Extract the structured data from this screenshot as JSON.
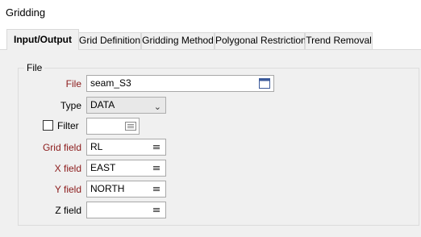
{
  "window": {
    "title": "Gridding"
  },
  "tabs": [
    {
      "label": "Input/Output",
      "active": true
    },
    {
      "label": "Grid Definition",
      "active": false
    },
    {
      "label": "Gridding Method",
      "active": false
    },
    {
      "label": "Polygonal Restriction",
      "active": false
    },
    {
      "label": "Trend Removal",
      "active": false
    }
  ],
  "file_group": {
    "legend": "File",
    "file": {
      "label": "File",
      "value": "seam_S3",
      "button_icon": "file-browse-icon"
    },
    "type": {
      "label": "Type",
      "value": "DATA",
      "dropdown_icon": "chevron-down-icon"
    },
    "filter": {
      "label": "Filter",
      "checked": false,
      "value": "",
      "button_icon": "filter-list-icon"
    },
    "grid_field": {
      "label": "Grid field",
      "value": "RL",
      "button_icon": "list-icon"
    },
    "x_field": {
      "label": "X field",
      "value": "EAST",
      "button_icon": "list-icon"
    },
    "y_field": {
      "label": "Y field",
      "value": "NORTH",
      "button_icon": "list-icon"
    },
    "z_field": {
      "label": "Z field",
      "value": "",
      "button_icon": "list-icon"
    }
  },
  "colors": {
    "required_label": "#8b1a1a",
    "panel_background": "#f0f0f0",
    "field_border": "#a8a8a8"
  }
}
